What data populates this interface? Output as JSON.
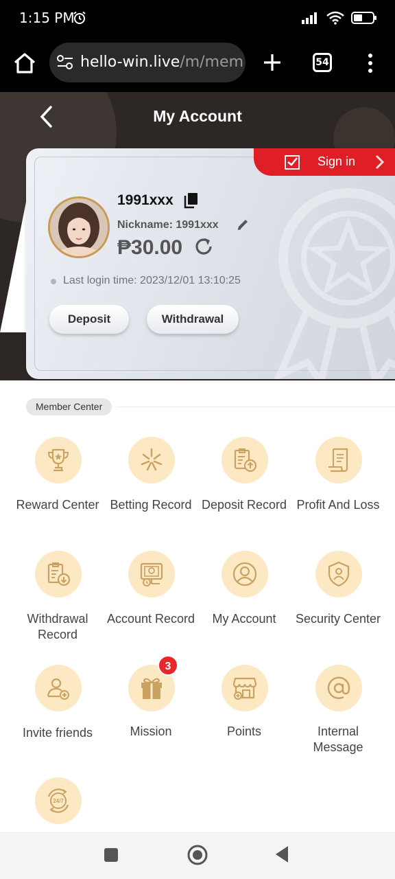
{
  "status_bar": {
    "time": "1:15 PM"
  },
  "browser": {
    "url_domain": "hello-win.live",
    "url_path": "/m/mem",
    "tab_count": "54"
  },
  "header": {
    "title": "My Account"
  },
  "card": {
    "signin_label": "Sign in",
    "username": "1991xxx",
    "nickname": "Nickname: 1991xxx",
    "balance": "₱30.00",
    "last_login": "Last login time: 2023/12/01 13:10:25",
    "deposit_label": "Deposit",
    "withdraw_label": "Withdrawal"
  },
  "member_center": {
    "title": "Member Center",
    "items": [
      {
        "label": "Reward Center",
        "icon": "trophy-icon"
      },
      {
        "label": "Betting Record",
        "icon": "betting-icon"
      },
      {
        "label": "Deposit Record",
        "icon": "deposit-record-icon"
      },
      {
        "label": "Profit And Loss",
        "icon": "receipt-icon"
      },
      {
        "label": "Withdrawal Record",
        "icon": "withdrawal-record-icon"
      },
      {
        "label": "Account Record",
        "icon": "account-record-icon"
      },
      {
        "label": "My Account",
        "icon": "user-icon"
      },
      {
        "label": "Security Center",
        "icon": "shield-icon"
      },
      {
        "label": "Invite friends",
        "icon": "invite-icon"
      },
      {
        "label": "Mission",
        "icon": "gift-icon",
        "badge": "3"
      },
      {
        "label": "Points",
        "icon": "store-icon"
      },
      {
        "label": "Internal Message",
        "icon": "at-icon"
      },
      {
        "label": "",
        "icon": "support-24-7-icon"
      }
    ]
  },
  "colors": {
    "accent_red": "#e01e25",
    "icon_bg": "#fde8c4",
    "icon_stroke": "#c9a262",
    "header_bg": "#2d2826"
  }
}
